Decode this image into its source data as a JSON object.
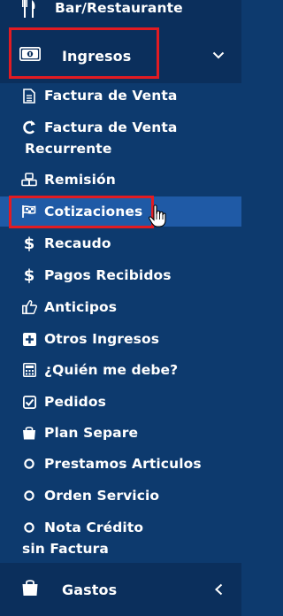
{
  "sidebar": {
    "top_item": {
      "label": "Bar/Restaurante",
      "icon": "utensils-icon"
    },
    "ingresos": {
      "label": "Ingresos",
      "icon": "money-bill-icon",
      "chevron": "chevron-down-icon"
    },
    "items": [
      {
        "label": "Factura de Venta",
        "icon": "file-text-icon"
      },
      {
        "label": "Factura de Venta",
        "label2": "Recurrente",
        "icon": "refresh-icon"
      },
      {
        "label": "Remisión",
        "icon": "cubes-icon"
      },
      {
        "label": "Cotizaciones",
        "icon": "flag-icon",
        "active": true
      },
      {
        "label": "Recaudo",
        "icon": "dollar-icon"
      },
      {
        "label": "Pagos Recibidos",
        "icon": "dollar-icon"
      },
      {
        "label": "Anticipos",
        "icon": "thumbs-up-icon"
      },
      {
        "label": "Otros Ingresos",
        "icon": "plus-square-icon"
      },
      {
        "label": "¿Quién me debe?",
        "icon": "calculator-icon"
      },
      {
        "label": "Pedidos",
        "icon": "check-square-icon"
      },
      {
        "label": "Plan Separe",
        "icon": "shopping-bag-icon"
      },
      {
        "label": "Prestamos Articulos",
        "icon": "circle-icon"
      },
      {
        "label": "Orden Servicio",
        "icon": "circle-icon"
      },
      {
        "label": "Nota Crédito",
        "label2": "sin Factura",
        "icon": "circle-icon"
      }
    ],
    "gastos": {
      "label": "Gastos",
      "icon": "shopping-bag-icon",
      "chevron": "chevron-left-icon"
    }
  },
  "colors": {
    "background": "#0d3a6e",
    "header_band": "#0b2f5c",
    "active_row": "#1f5aa6",
    "highlight_box": "#e21b22"
  }
}
